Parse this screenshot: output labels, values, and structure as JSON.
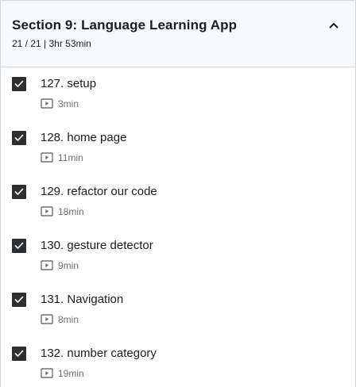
{
  "section": {
    "title": "Section 9: Language Learning App",
    "meta": "21 / 21 | 3hr 53min",
    "toggle_icon": "chevron-up-icon"
  },
  "lectures": [
    {
      "title": "127. setup",
      "duration": "3min",
      "completed": true,
      "type_icon": "video-icon"
    },
    {
      "title": "128. home page",
      "duration": "11min",
      "completed": true,
      "type_icon": "video-icon"
    },
    {
      "title": "129. refactor our code",
      "duration": "18min",
      "completed": true,
      "type_icon": "video-icon"
    },
    {
      "title": "130. gesture detector",
      "duration": "9min",
      "completed": true,
      "type_icon": "video-icon"
    },
    {
      "title": "131. Navigation",
      "duration": "8min",
      "completed": true,
      "type_icon": "video-icon"
    },
    {
      "title": "132. number category",
      "duration": "19min",
      "completed": true,
      "type_icon": "video-icon"
    }
  ],
  "colors": {
    "checkbox_fill": "#2d2f31",
    "header_bg": "#f7f9fa",
    "text": "#1c1d1f",
    "muted_text": "#6a6f73"
  }
}
